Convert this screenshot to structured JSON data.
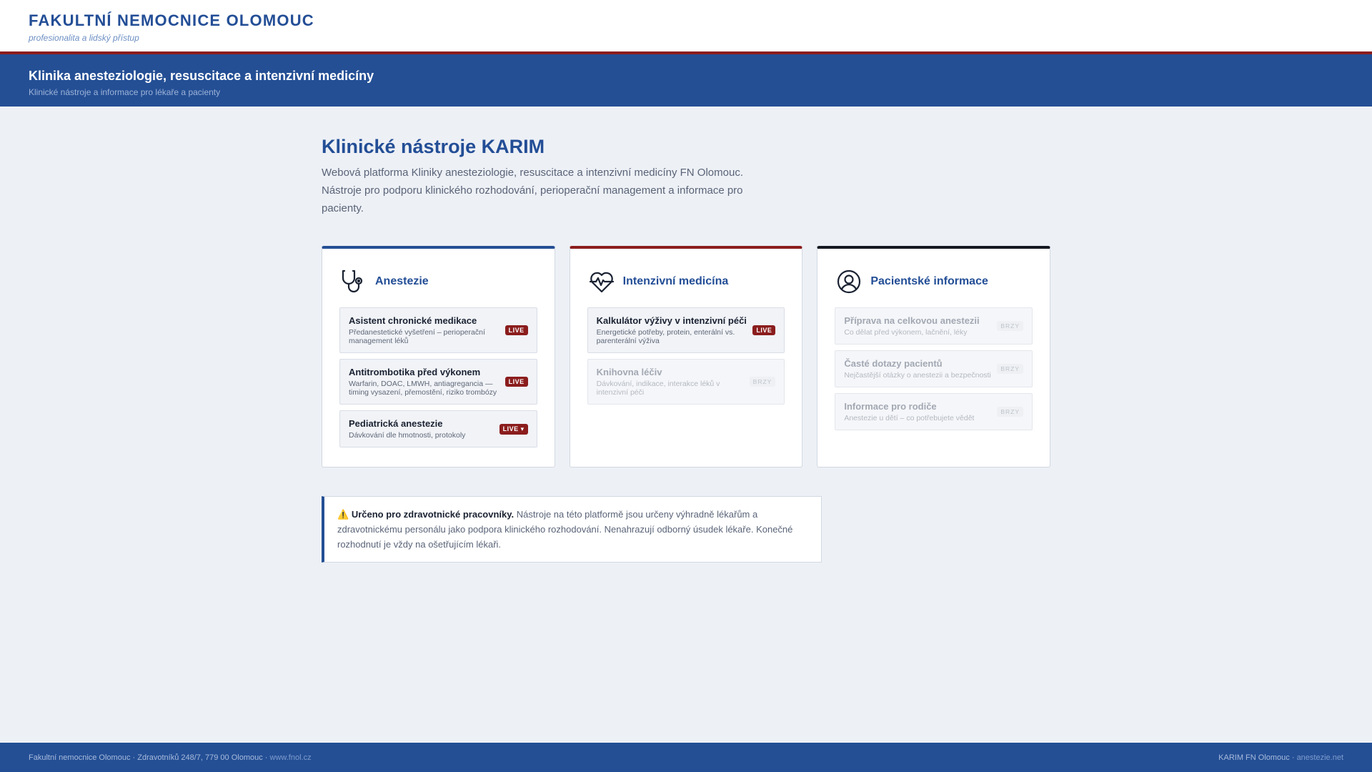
{
  "header": {
    "brand_name": "FAKULTNÍ NEMOCNICE OLOMOUC",
    "brand_tagline": "profesionalita a lidský přístup"
  },
  "clinic_bar": {
    "title": "Klinika anesteziologie, resuscitace a intenzivní medicíny",
    "subtitle": "Klinické nástroje a informace pro lékaře a pacienty"
  },
  "main": {
    "title": "Klinické nástroje KARIM",
    "intro": "Webová platforma Kliniky anesteziologie, resuscitace a intenzivní medicíny FN Olomouc. Nástroje pro podporu klinického rozhodování, perioperační management a informace pro pacienty."
  },
  "cards": [
    {
      "title": "Anestezie",
      "icon": "stethoscope-icon",
      "accent": "#244f95",
      "items": [
        {
          "title": "Asistent chronické medikace",
          "desc": "Předanestetické vyšetření – perioperační management léků",
          "badge": "LIVE"
        },
        {
          "title": "Antitrombotika před výkonem",
          "desc": "Warfarin, DOAC, LMWH, antiagregancia — timing vysazení, přemostění, riziko trombózy",
          "badge": "LIVE"
        },
        {
          "title": "Pediatrická anestezie",
          "desc": "Dávkování dle hmotnosti, protokoly",
          "badge": "LIVE ▾"
        }
      ]
    },
    {
      "title": "Intenzivní medicína",
      "icon": "heart-pulse-icon",
      "accent": "#8b1d1d",
      "items": [
        {
          "title": "Kalkulátor výživy v intenzivní péči",
          "desc": "Energetické potřeby, protein, enterální vs. parenterální výživa",
          "badge": "LIVE"
        },
        {
          "title": "Knihovna léčiv",
          "desc": "Dávkování, indikace, interakce léků v intenzivní péči",
          "badge": "BRZY"
        }
      ]
    },
    {
      "title": "Pacientské informace",
      "icon": "user-circle-icon",
      "accent": "#141821",
      "items": [
        {
          "title": "Příprava na celkovou anestezii",
          "desc": "Co dělat před výkonem, lačnění, léky",
          "badge": "BRZY"
        },
        {
          "title": "Časté dotazy pacientů",
          "desc": "Nejčastější otázky o anestezii a bezpečnosti",
          "badge": "BRZY"
        },
        {
          "title": "Informace pro rodiče",
          "desc": "Anestezie u dětí – co potřebujete vědět",
          "badge": "BRZY"
        }
      ]
    }
  ],
  "notice": {
    "icon": "warning-icon",
    "emoji": "⚠️",
    "strong": "Určeno pro zdravotnické pracovníky.",
    "text": "Nástroje na této platformě jsou určeny výhradně lékařům a zdravotnickému personálu jako podpora klinického rozhodování. Nenahrazují odborný úsudek lékaře. Konečné rozhodnutí je vždy na ošetřujícím lékaři."
  },
  "footer": {
    "left_text": "Fakultní nemocnice Olomouc · Zdravotníků 248/7, 779 00 Olomouc · ",
    "left_link": "www.fnol.cz",
    "right_text": "KARIM FN Olomouc · ",
    "right_link": "anestezie.net"
  },
  "colors": {
    "brand_blue": "#244f95",
    "brand_red": "#8b1d1d",
    "background": "#edf0f5"
  }
}
